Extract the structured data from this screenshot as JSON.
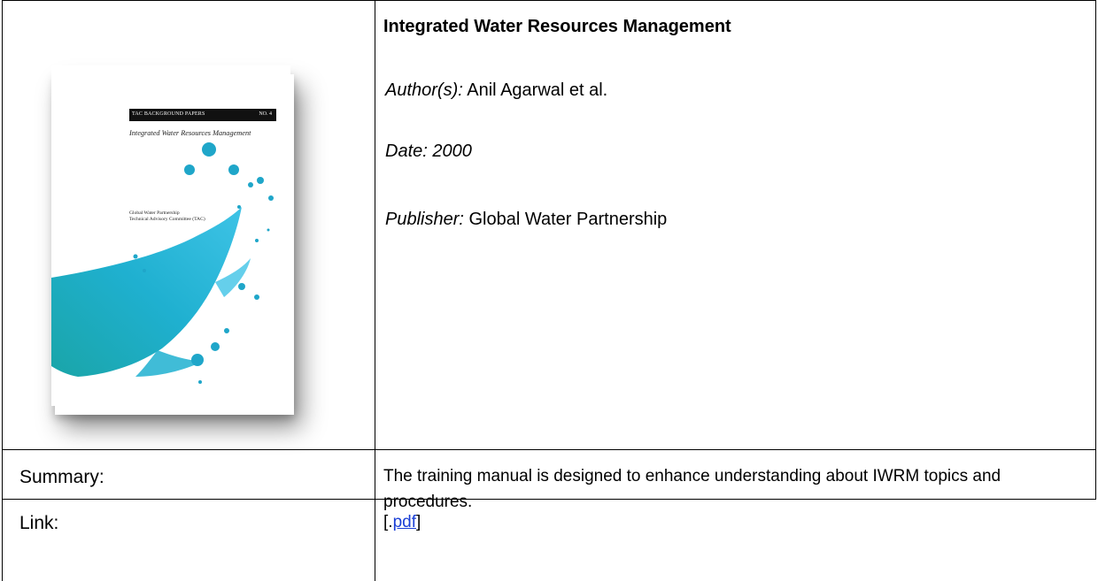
{
  "document": {
    "title": "Integrated Water Resources Management",
    "author_label": "Author(s):",
    "author_value": "Anil Agarwal et al.",
    "date_text": "Date: 2000",
    "publisher_label": "Publisher:",
    "publisher_value": "Global Water Partnership",
    "summary_label": "Summary:",
    "summary_text": "The training manual is designed to enhance understanding about IWRM topics and procedures.",
    "link_label": "Link:",
    "link_prefix": "[.",
    "link_text": "pdf",
    "link_suffix": "]"
  },
  "cover": {
    "series": "TAC BACKGROUND PAPERS",
    "number": "NO. 4",
    "title": "Integrated Water Resources Management",
    "publisher_line1": "Global Water Partnership",
    "publisher_line2": "Technical Advisory Committee (TAC)",
    "accent_color": "#1fa6c9"
  },
  "colors": {
    "border": "#000000",
    "link": "#1a3fd6"
  }
}
